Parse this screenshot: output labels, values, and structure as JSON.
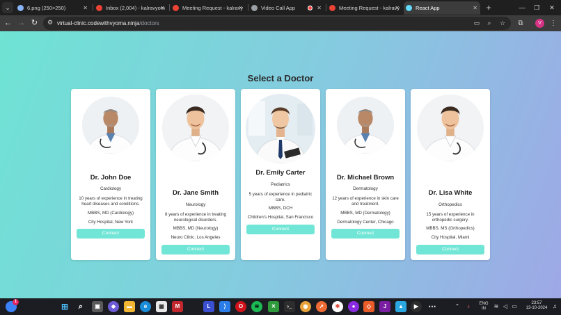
{
  "browser": {
    "tabs": [
      {
        "label": "6.png (250×250)",
        "color": "#8ab4f8"
      },
      {
        "label": "Inbox (2,004) - kalravyom",
        "color": "#ea4335"
      },
      {
        "label": "Meeting Request - kalravy",
        "color": "#ea4335"
      },
      {
        "label": "Video Call App",
        "color": "#9aa0a6"
      },
      {
        "label": "Meeting Request - kalravy",
        "color": "#ea4335"
      },
      {
        "label": "React App",
        "color": "#61dafb"
      }
    ],
    "url_host": "virtual-clinic.codewithvyoma.ninja",
    "url_path": "/doctors",
    "profile_initial": "V"
  },
  "page": {
    "title": "Select a Doctor",
    "connect_label": "Connect"
  },
  "doctors": [
    {
      "name": "Dr. John Doe",
      "specialty": "Cardiology",
      "experience": "10 years of experience in treating heart diseases and conditions.",
      "qualification": "MBBS, MD (Cardiology)",
      "location": "City Hospital, New York"
    },
    {
      "name": "Dr. Jane Smith",
      "specialty": "Neurology",
      "experience": "8 years of experience in treating neurological disorders.",
      "qualification": "MBBS, MD (Neurology)",
      "location": "Neuro Clinic, Los Angeles"
    },
    {
      "name": "Dr. Emily Carter",
      "specialty": "Pediatrics",
      "experience": "5 years of experience in pediatric care.",
      "qualification": "MBBS, DCH",
      "location": "Children's Hospital, San Francisco"
    },
    {
      "name": "Dr. Michael Brown",
      "specialty": "Dermatology",
      "experience": "12 years of experience in skin care and treatment.",
      "qualification": "MBBS, MD (Dermatology)",
      "location": "Dermatology Center, Chicago"
    },
    {
      "name": "Dr. Lisa White",
      "specialty": "Orthopedics",
      "experience": "15 years of experience in orthopedic surgery.",
      "qualification": "MBBS, MS (Orthopedics)",
      "location": "City Hospital, Miami"
    }
  ],
  "taskbar": {
    "notification_badge": "1",
    "language_top": "ENG",
    "language_bottom": "IN",
    "time": "23:57",
    "date": "13-10-2024"
  },
  "colors": {
    "accent": "#72e6d6",
    "gradient_start": "#6fe3d4",
    "gradient_end": "#9ea8e6"
  }
}
